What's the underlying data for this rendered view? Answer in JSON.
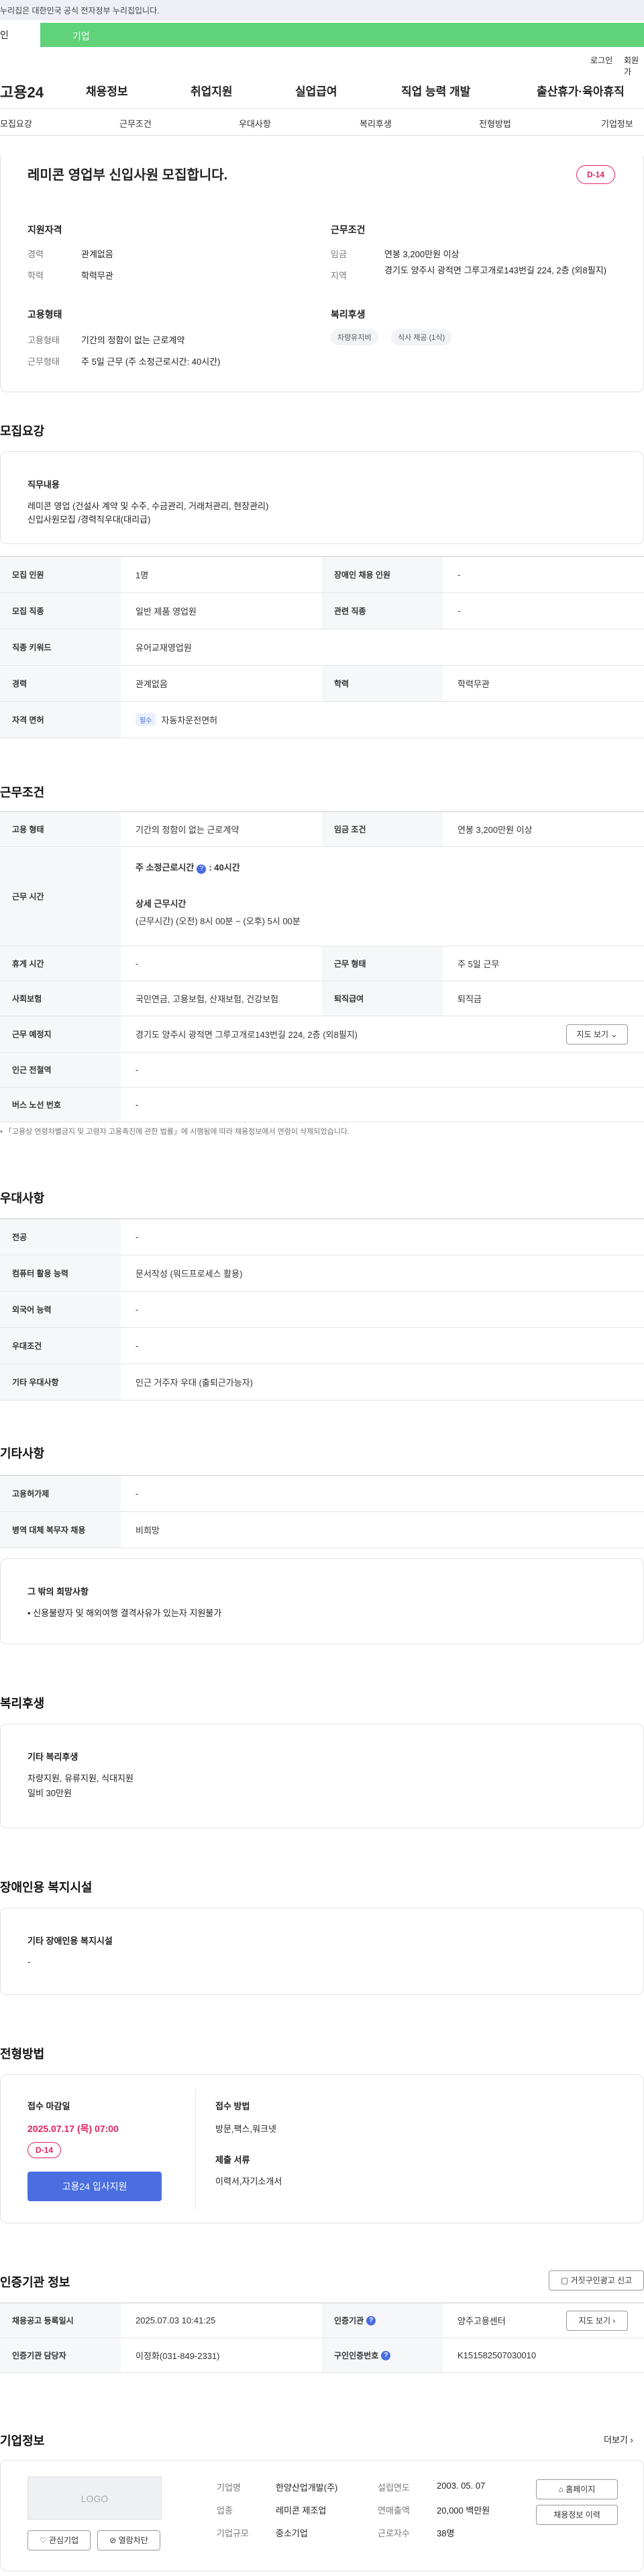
{
  "topbar": {
    "notice": "누리집은 대한민국 공식 전자정부 누리집입니다."
  },
  "user_tabs": {
    "individual": "인",
    "business": "기업"
  },
  "auth": {
    "login": "로그인",
    "signup": "회원가"
  },
  "gnb": {
    "logo": "고용24",
    "menu": [
      "채용정보",
      "취업지원",
      "실업급여",
      "직업 능력 개발",
      "출산휴가·육아휴직"
    ]
  },
  "subnav": [
    "모집요강",
    "근무조건",
    "우대사항",
    "복리후생",
    "전형방법",
    "기업정보"
  ],
  "summary": {
    "title": "레미콘 영업부 신입사원 모집합니다.",
    "dday": "D-14",
    "qualification_title": "지원자격",
    "career_label": "경력",
    "career_value": "관계없음",
    "edu_label": "학력",
    "edu_value": "학력무관",
    "employment_title": "고용형태",
    "emptype_label": "고용형태",
    "emptype_value": "기간의 정함이 없는 근로계약",
    "worktype_label": "근무형태",
    "worktype_value": "주 5일 근무 (주 소정근로시간: 40시간)",
    "workcond_title": "근무조건",
    "wage_label": "임금",
    "wage_value": "연봉 3,200만원 이상",
    "region_label": "지역",
    "region_value": "경기도 양주시 광적면 그루고개로143번길 224, 2층 (외8필지)",
    "benefit_title": "복리후생",
    "benefit_chips": [
      "차량유지비",
      "식사 제공 (1식)"
    ]
  },
  "recruit": {
    "heading": "모집요강",
    "duty_title": "직무내용",
    "duty_lines": [
      "레미콘 영업 (건설사 계약 및 수주, 수금관리, 거래처관리, 현장관리)",
      "신입사원모집 /경력직우대(대리급)"
    ],
    "rows": [
      [
        "모집 인원",
        "1명",
        "장애인 채용 인원",
        "-"
      ],
      [
        "모집 직종",
        "일반 제품 영업원",
        "관련 직종",
        "-"
      ],
      [
        "직종 키워드",
        "유어교재영업원"
      ],
      [
        "경력",
        "관계없음",
        "학력",
        "학력무관"
      ],
      [
        "자격 면허",
        "자동차운전면허"
      ]
    ],
    "license_tag": "필수"
  },
  "workcond": {
    "heading": "근무조건",
    "emp_type_label": "고용 형태",
    "emp_type_value": "기간의 정함이 없는 근로계약",
    "wage_label": "임금 조건",
    "wage_value": "연봉 3,200만원 이상",
    "hours_label": "근무 시간",
    "hours_main_label": "주 소정근로시간",
    "hours_main_value": ": 40시간",
    "hours_detail_label": "상세 근무시간",
    "hours_detail_value": "(근무시간) (오전) 8시 00분 ~ (오후) 5시 00분",
    "rest_label": "휴게 시간",
    "rest_value": "-",
    "form_label": "근무 형태",
    "form_value": "주 5일 근무",
    "insurance_label": "사회보험",
    "insurance_value": "국민연금, 고용보험, 산재보험, 건강보험",
    "severance_label": "퇴직급여",
    "severance_value": "퇴직금",
    "place_label": "근무 예정지",
    "place_value": "경기도 양주시 광적면 그루고개로143번길 224, 2층 (외8필지)",
    "map_btn": "지도 보기",
    "subway_label": "인근 전철역",
    "subway_value": "-",
    "bus_label": "버스 노선 번호",
    "bus_value": "-",
    "note": "「고용상 연령차별금지 및 고령자 고용촉진에 관한 법률」에 시행됨에 따라 채용정보에서 연령이 삭제되었습니다."
  },
  "preference": {
    "heading": "우대사항",
    "rows": [
      [
        "전공",
        "-"
      ],
      [
        "컴퓨터 활용 능력",
        "문서작성 (워드프로세스 활용)"
      ],
      [
        "외국어 능력",
        "-"
      ],
      [
        "우대조건",
        "-"
      ],
      [
        "기타 우대사항",
        "인근 거주자 우대 (출퇴근가능자)"
      ]
    ]
  },
  "etc": {
    "heading": "기타사항",
    "rows": [
      [
        "고용허가제",
        "-"
      ],
      [
        "병역 대체 복무자 채용",
        "비희망"
      ]
    ],
    "extra_title": "그 밖의 희망사항",
    "extra_line": "• 신용불량자 및 해외여행 결격사유가 있는자 지원불가"
  },
  "welfare": {
    "heading": "복리후생",
    "title": "기타 복리후생",
    "lines": [
      "차량지원, 유류지원, 식대지원",
      "일비 30만원"
    ]
  },
  "disability": {
    "heading": "장애인용 복지시설",
    "title": "기타 장애인용 복지시설",
    "value": "-"
  },
  "selection": {
    "heading": "전형방법",
    "deadline_title": "접수 마감일",
    "deadline_value": "2025.07.17 (목) 07:00",
    "dday": "D-14",
    "apply_btn": "고용24 입사지원",
    "method_title": "접수 방법",
    "method_value": "방문,팩스,워크넷",
    "docs_title": "제출 서류",
    "docs_value": "이력서,자기소개서"
  },
  "agency": {
    "heading": "인증기관 정보",
    "report_btn": "거짓구인광고 신고",
    "reg_label": "채용공고 등록일시",
    "reg_value": "2025.07.03 10:41:25",
    "org_label": "인증기관",
    "org_value": "양주고용센터",
    "map_btn": "지도 보기",
    "manager_label": "인증기관 담당자",
    "manager_value": "이정화(031-849-2331)",
    "id_label": "구인인증번호",
    "id_value": "K151582507030010"
  },
  "company": {
    "heading": "기업정보",
    "more": "더보기",
    "logo_text": "LOGO",
    "fav_btn": "관심기업",
    "block_btn": "열람차단",
    "name_label": "기업명",
    "name_value": "한양산업개발(주)",
    "founded_label": "설립연도",
    "founded_value": "2003. 05. 07",
    "industry_label": "업종",
    "industry_value": "레미콘 제조업",
    "sales_label": "연매출액",
    "sales_value": "20,000 백만원",
    "size_label": "기업규모",
    "size_value": "중소기업",
    "staff_label": "근로자수",
    "staff_value": "38명",
    "homepage_btn": "홈페이지",
    "jobs_btn": "채용정보 이력"
  }
}
